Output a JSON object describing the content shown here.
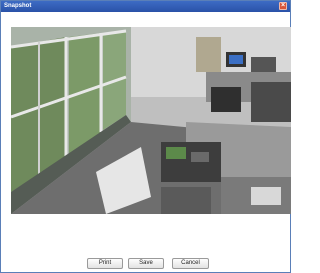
{
  "window": {
    "title": "Snapshot",
    "close_icon": "close-icon"
  },
  "snapshot": {
    "description_icon": "camera-snapshot-image"
  },
  "buttons": {
    "print": "Print",
    "save": "Save",
    "cancel": "Cancel"
  },
  "colors": {
    "titlebar": "#2a52a8",
    "close": "#d9553a"
  }
}
